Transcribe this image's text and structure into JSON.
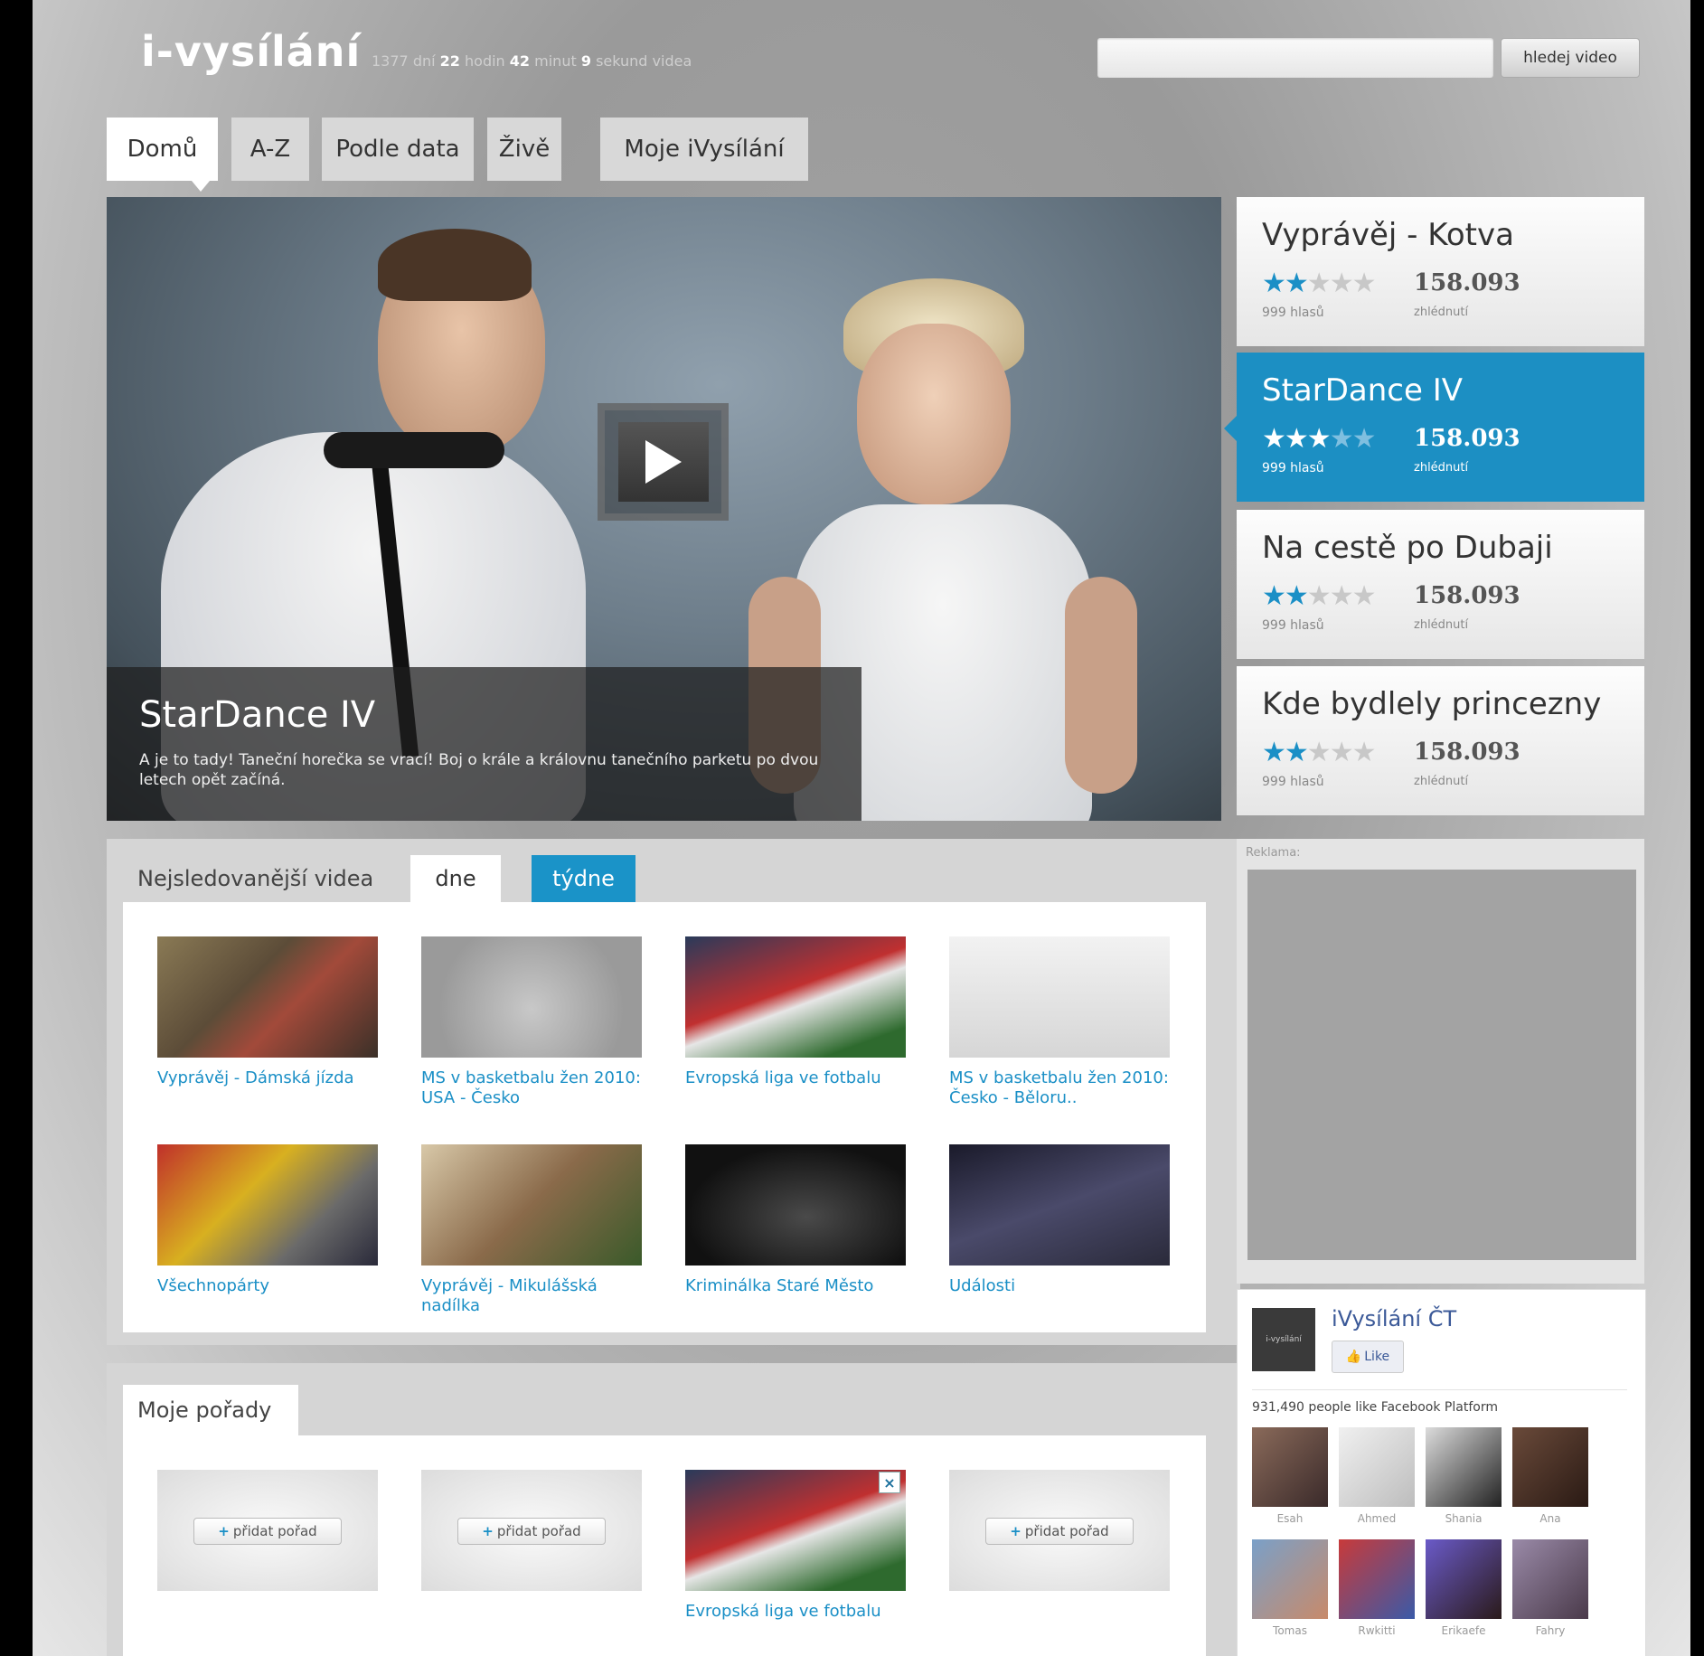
{
  "header": {
    "logo": "i-vysílání",
    "counter": {
      "days": "1377",
      "days_unit": "dní",
      "hours": "22",
      "hours_unit": "hodin",
      "minutes": "42",
      "minutes_unit": "minut",
      "seconds": "9",
      "seconds_unit": "sekund videa"
    },
    "search": {
      "placeholder": "",
      "button": "hledej video"
    }
  },
  "nav": {
    "tabs": [
      {
        "label": "Domů",
        "active": true
      },
      {
        "label": "A-Z"
      },
      {
        "label": "Podle data"
      },
      {
        "label": "Živě"
      },
      {
        "label": "Moje iVysílání"
      }
    ]
  },
  "hero": {
    "title": "StarDance IV",
    "description": "A je to tady! Taneční horečka se vrací! Boj o krále a královnu tanečního parketu po dvou letech opět začíná."
  },
  "featured": [
    {
      "title": "Vyprávěj - Kotva",
      "rating": 2,
      "votes": "999 hlasů",
      "views": "158.093",
      "views_label": "zhlédnutí"
    },
    {
      "title": "StarDance IV",
      "rating": 3,
      "votes": "999 hlasů",
      "views": "158.093",
      "views_label": "zhlédnutí",
      "active": true
    },
    {
      "title": "Na cestě po Dubaji",
      "rating": 2,
      "votes": "999 hlasů",
      "views": "158.093",
      "views_label": "zhlédnutí"
    },
    {
      "title": "Kde bydlely princezny",
      "rating": 2,
      "votes": "999 hlasů",
      "views": "158.093",
      "views_label": "zhlédnutí"
    }
  ],
  "popular": {
    "title": "Nejsledovanější videa",
    "tab_day": "dne",
    "tab_week": "týdne",
    "videos": [
      {
        "label": "Vyprávěj - Dámská jízda"
      },
      {
        "label": "MS v basketbalu žen 2010: USA - Česko"
      },
      {
        "label": "Evropská liga ve fotbalu"
      },
      {
        "label": "MS v basketbalu žen 2010: Česko - Běloru.."
      },
      {
        "label": "Všechnopárty"
      },
      {
        "label": "Vyprávěj - Mikulášská nadílka"
      },
      {
        "label": "Kriminálka Staré Město"
      },
      {
        "label": "Události"
      }
    ]
  },
  "my_shows": {
    "title": "Moje pořady",
    "add_label": "přidat pořad",
    "show_label": "Evropská liga ve fotbalu"
  },
  "ad": {
    "label": "Reklama:"
  },
  "facebook": {
    "logo_text": "i-vysílání",
    "name": "iVysílání ČT",
    "like": "Like",
    "count": "931,490 people like Facebook Platform",
    "fans": [
      "Esah",
      "Ahmed",
      "Shania",
      "Ana",
      "Tomas",
      "Rwkitti",
      "Erikaefe",
      "Fahry"
    ]
  },
  "colors": {
    "accent": "#1a93c8",
    "link": "#1a8fc6",
    "facebook": "#3b5998"
  }
}
